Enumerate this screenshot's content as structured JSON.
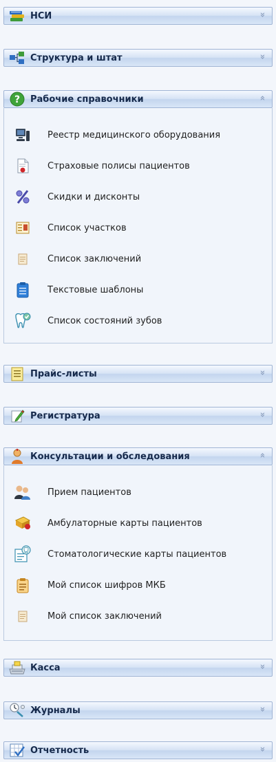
{
  "groups": [
    {
      "label": "НСИ",
      "icon": "books-icon",
      "expanded": false
    },
    {
      "label": "Структура и штат",
      "icon": "org-structure-icon",
      "expanded": false
    },
    {
      "label": "Рабочие справочники",
      "icon": "question-icon",
      "expanded": true,
      "items": [
        {
          "label": "Реестр медицинского оборудования",
          "icon": "computer-icon"
        },
        {
          "label": "Страховые полисы пациентов",
          "icon": "insurance-document-icon"
        },
        {
          "label": "Скидки и дисконты",
          "icon": "percent-icon"
        },
        {
          "label": "Список участков",
          "icon": "sections-list-icon"
        },
        {
          "label": "Список заключений",
          "icon": "conclusions-icon"
        },
        {
          "label": "Текстовые шаблоны",
          "icon": "clipboard-icon"
        },
        {
          "label": "Список состояний зубов",
          "icon": "tooth-icon"
        }
      ]
    },
    {
      "label": "Прайс-листы",
      "icon": "price-list-icon",
      "expanded": false
    },
    {
      "label": "Регистратура",
      "icon": "registry-pencil-icon",
      "expanded": false
    },
    {
      "label": "Консультации и обследования",
      "icon": "consultation-icon",
      "expanded": true,
      "items": [
        {
          "label": "Прием пациентов",
          "icon": "patients-icon"
        },
        {
          "label": "Амбулаторные карты пациентов",
          "icon": "patient-card-icon"
        },
        {
          "label": "Стоматологические карты пациентов",
          "icon": "dental-card-icon"
        },
        {
          "label": "Мой список шифров МКБ",
          "icon": "icd-codes-icon"
        },
        {
          "label": "Мой список заключений",
          "icon": "conclusions-icon"
        }
      ]
    },
    {
      "label": "Касса",
      "icon": "cash-register-icon",
      "expanded": false
    },
    {
      "label": "Журналы",
      "icon": "journals-icon",
      "expanded": false
    },
    {
      "label": "Отчетность",
      "icon": "report-icon",
      "expanded": false
    }
  ],
  "chevrons": {
    "collapsed": "»",
    "expanded": "«"
  },
  "colors": {
    "header_text": "#15294b",
    "header_border": "#9fb4d4",
    "panel_bg": "#f1f5fb",
    "chevron": "#7f94b6"
  }
}
